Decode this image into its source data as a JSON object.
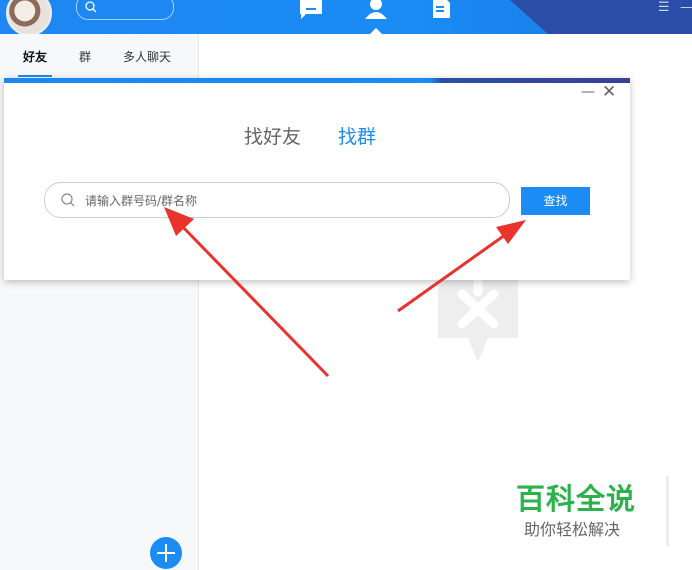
{
  "sidebar": {
    "tabs": [
      {
        "label": "好友",
        "active": true
      },
      {
        "label": "群",
        "active": false
      },
      {
        "label": "多人聊天",
        "active": false
      }
    ],
    "add_icon": "plus-icon"
  },
  "dialog": {
    "tabs": [
      {
        "label": "找好友",
        "active": false
      },
      {
        "label": "找群",
        "active": true
      }
    ],
    "minimize_symbol": "—",
    "close_symbol": "✕",
    "search": {
      "placeholder": "请输入群号码/群名称",
      "value": ""
    },
    "find_button": "查找"
  },
  "watermark_brand": {
    "title": "百科全说",
    "subtitle": "助你轻松解决"
  },
  "colors": {
    "accent": "#1a8cf4",
    "arrow": "#e8342c",
    "brand_green": "#2bb24c"
  },
  "icons": [
    "search-icon",
    "message-icon",
    "contacts-icon",
    "document-icon",
    "menu-icon",
    "plus-icon",
    "close-icon"
  ]
}
